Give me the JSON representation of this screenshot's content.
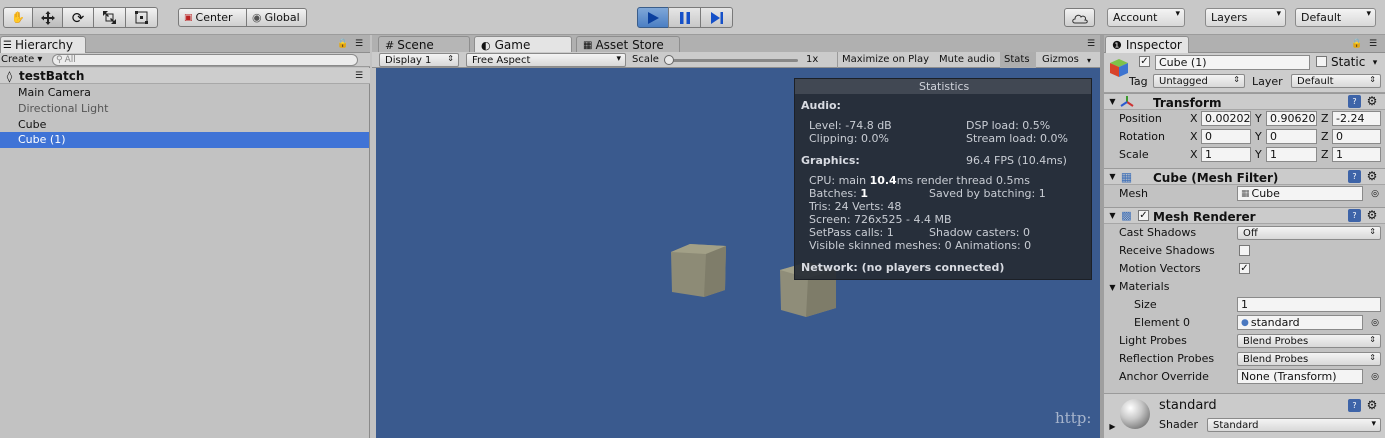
{
  "toolbar": {
    "pivot": "Center",
    "space": "Global",
    "account": "Account",
    "layers": "Layers",
    "layout": "Default"
  },
  "hierarchy": {
    "tab": "Hierarchy",
    "create": "Create",
    "search_placeholder": "All",
    "scene": "testBatch",
    "items": [
      {
        "label": "Main Camera"
      },
      {
        "label": "Directional Light"
      },
      {
        "label": "Cube"
      },
      {
        "label": "Cube (1)"
      }
    ]
  },
  "center_tabs": {
    "scene": "Scene",
    "game": "Game",
    "asset_store": "Asset Store"
  },
  "game_bar": {
    "display": "Display 1",
    "aspect": "Free Aspect",
    "scale_label": "Scale",
    "scale_value": "1x",
    "maximize": "Maximize on Play",
    "mute": "Mute audio",
    "stats": "Stats",
    "gizmos": "Gizmos"
  },
  "stats": {
    "title": "Statistics",
    "audio": "Audio:",
    "level": "Level: -74.8 dB",
    "clipping": "Clipping: 0.0%",
    "dsp": "DSP load: 0.5%",
    "stream": "Stream load: 0.0%",
    "graphics": "Graphics:",
    "fps": "96.4 FPS (10.4ms)",
    "cpu_a": "CPU: main ",
    "cpu_b": "10.4",
    "cpu_c": "ms  render thread 0.5ms",
    "batches_a": "Batches: ",
    "batches_b": "1",
    "saved": "Saved by batching: 1",
    "tris": "Tris: 24   Verts: 48",
    "screen": "Screen: 726x525 - 4.4 MB",
    "setpass": "SetPass calls: 1",
    "shadow": "Shadow casters: 0",
    "skinned": "Visible skinned meshes: 0  Animations: 0",
    "network": "Network: (no players connected)"
  },
  "inspector": {
    "tab": "Inspector",
    "name": "Cube (1)",
    "static": "Static",
    "tag_label": "Tag",
    "tag": "Untagged",
    "layer_label": "Layer",
    "layer": "Default",
    "transform": {
      "title": "Transform",
      "position": "Position",
      "rotation": "Rotation",
      "scale": "Scale",
      "x": "X",
      "y": "Y",
      "z": "Z",
      "pos_x": "0.00202",
      "pos_y": "0.90620",
      "pos_z": "-2.24",
      "rot_x": "0",
      "rot_y": "0",
      "rot_z": "0",
      "sc_x": "1",
      "sc_y": "1",
      "sc_z": "1"
    },
    "mesh_filter": {
      "title": "Cube (Mesh Filter)",
      "mesh_label": "Mesh",
      "mesh": "Cube"
    },
    "mesh_renderer": {
      "title": "Mesh Renderer",
      "cast_label": "Cast Shadows",
      "cast": "Off",
      "receive_label": "Receive Shadows",
      "motion_label": "Motion Vectors",
      "materials": "Materials",
      "size_label": "Size",
      "size": "1",
      "element_label": "Element 0",
      "element": "standard",
      "light_label": "Light Probes",
      "light": "Blend Probes",
      "reflection_label": "Reflection Probes",
      "reflection": "Blend Probes",
      "anchor_label": "Anchor Override",
      "anchor": "None (Transform)"
    },
    "material": {
      "name": "standard",
      "shader_label": "Shader",
      "shader": "Standard"
    }
  },
  "watermark": "http:"
}
